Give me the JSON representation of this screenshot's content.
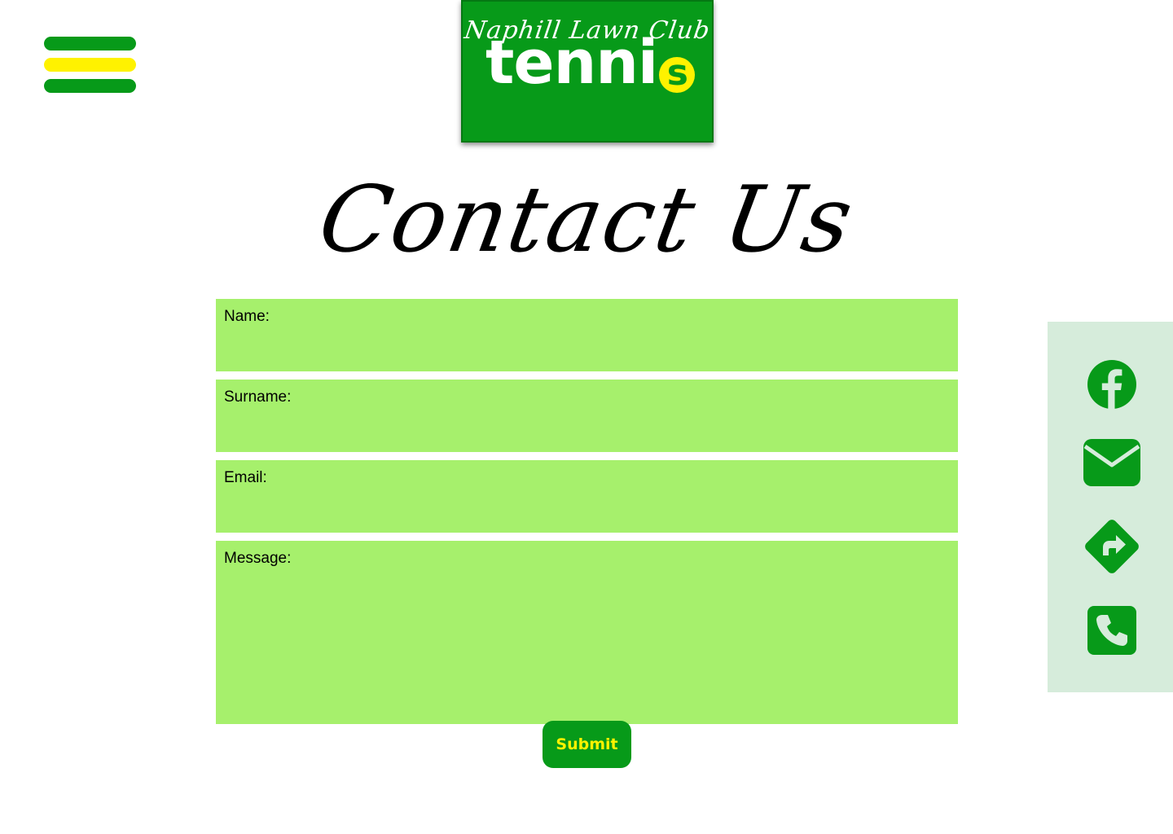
{
  "header": {
    "menu_icon": "hamburger-menu-icon",
    "logo": {
      "script_text": "Naphill Lawn Club",
      "word_text": "tenni",
      "ball_letter": "s"
    }
  },
  "page": {
    "title": "Contact Us"
  },
  "form": {
    "name_label": "Name:",
    "surname_label": "Surname:",
    "email_label": "Email:",
    "message_label": "Message:",
    "name_value": "",
    "surname_value": "",
    "email_value": "",
    "message_value": "",
    "submit_label": "Submit"
  },
  "social": {
    "items": [
      {
        "icon": "facebook-icon"
      },
      {
        "icon": "email-icon"
      },
      {
        "icon": "directions-icon"
      },
      {
        "icon": "phone-icon"
      }
    ]
  },
  "colors": {
    "brand_green": "#079a19",
    "brand_yellow": "#fff200",
    "field_green": "#a6f06c",
    "panel_bg": "#d6ecdb"
  }
}
